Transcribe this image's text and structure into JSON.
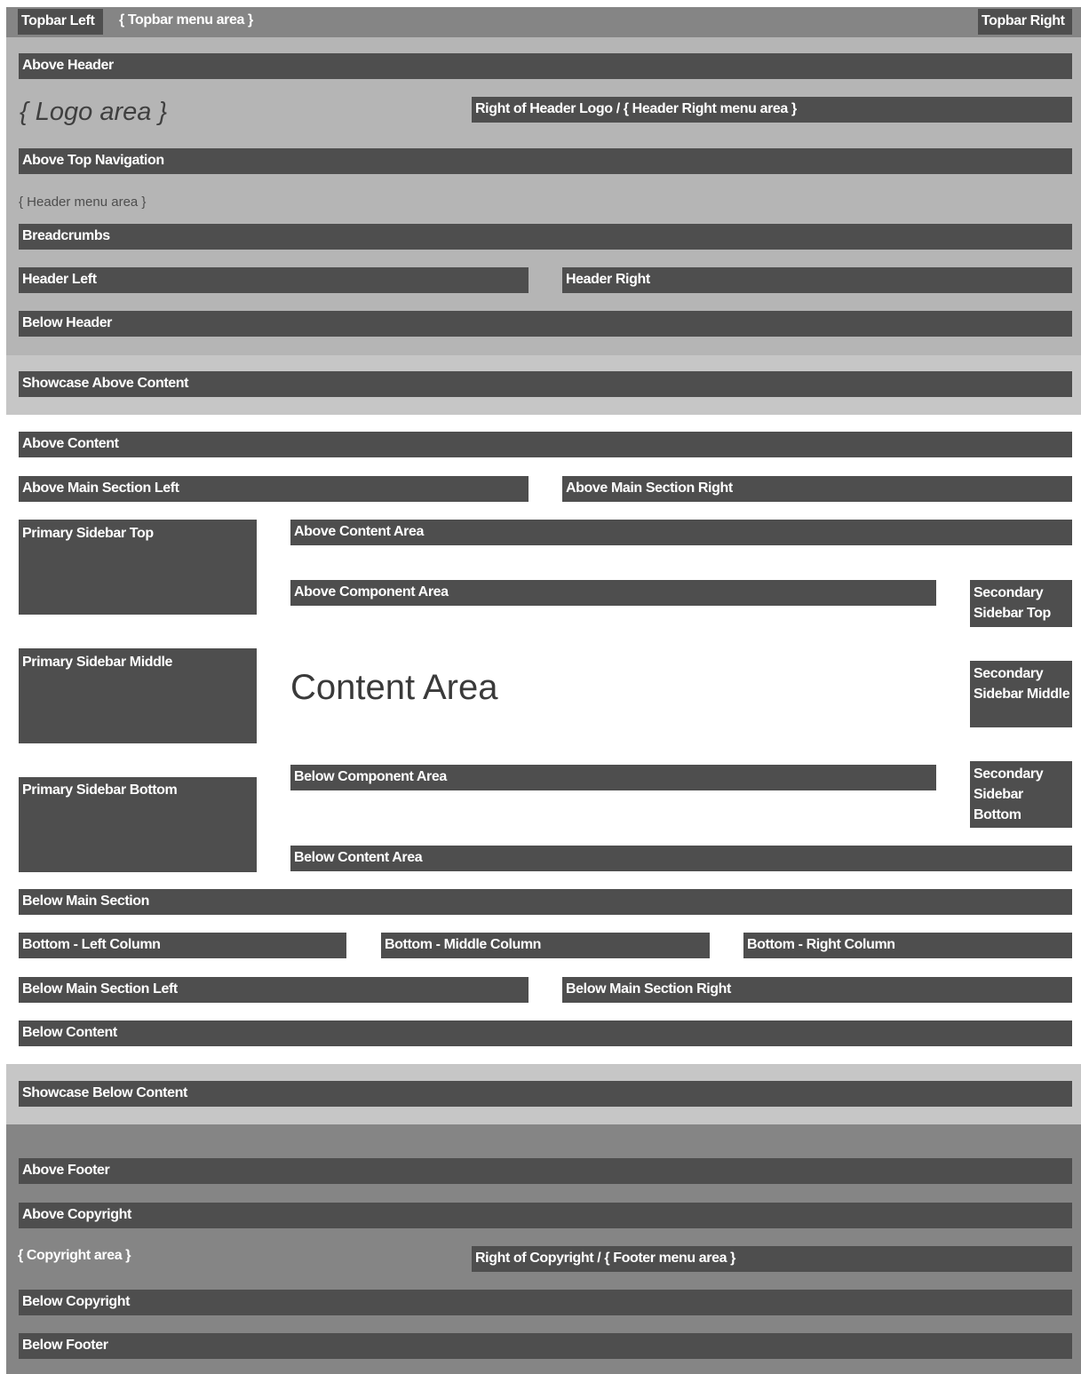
{
  "colors": {
    "block": "#4e4e4e",
    "topbar": "#858585",
    "header": "#b5b5b5",
    "showcase": "#c6c6c6",
    "content": "#ffffff",
    "footer": "#858585"
  },
  "topbar": {
    "left": "Topbar Left",
    "menu": "{ Topbar menu area }",
    "right": "Topbar Right"
  },
  "header": {
    "above_header": "Above Header",
    "logo": "{ Logo area }",
    "right_of_logo": "Right of Header Logo / { Header Right menu area }",
    "above_top_nav": "Above Top Navigation",
    "menu": "{ Header menu area }",
    "breadcrumbs": "Breadcrumbs",
    "header_left": "Header Left",
    "header_right": "Header Right",
    "below_header": "Below Header"
  },
  "showcase_top": {
    "label": "Showcase Above Content"
  },
  "content": {
    "above_content": "Above Content",
    "above_main_left": "Above Main Section Left",
    "above_main_right": "Above Main Section Right",
    "primary_top": "Primary Sidebar Top",
    "primary_middle": "Primary Sidebar Middle",
    "primary_bottom": "Primary Sidebar Bottom",
    "above_content_area": "Above Content Area",
    "above_component_area": "Above Component Area",
    "content_area": "Content Area",
    "below_component_area": "Below Component Area",
    "below_content_area": "Below Content Area",
    "secondary_top": "Secondary Sidebar Top",
    "secondary_middle": "Secondary Sidebar Middle",
    "secondary_bottom": "Secondary Sidebar Bottom",
    "below_main_section": "Below Main Section",
    "bottom_left": "Bottom - Left Column",
    "bottom_middle": "Bottom - Middle Column",
    "bottom_right": "Bottom - Right Column",
    "below_main_left": "Below Main Section Left",
    "below_main_right": "Below Main Section Right",
    "below_content": "Below Content"
  },
  "showcase_bottom": {
    "label": "Showcase Below Content"
  },
  "footer": {
    "above_footer": "Above Footer",
    "above_copyright": "Above Copyright",
    "copyright": "{ Copyright area }",
    "right_of_copyright": "Right of Copyright / { Footer menu area }",
    "below_copyright": "Below Copyright",
    "below_footer": "Below Footer"
  }
}
